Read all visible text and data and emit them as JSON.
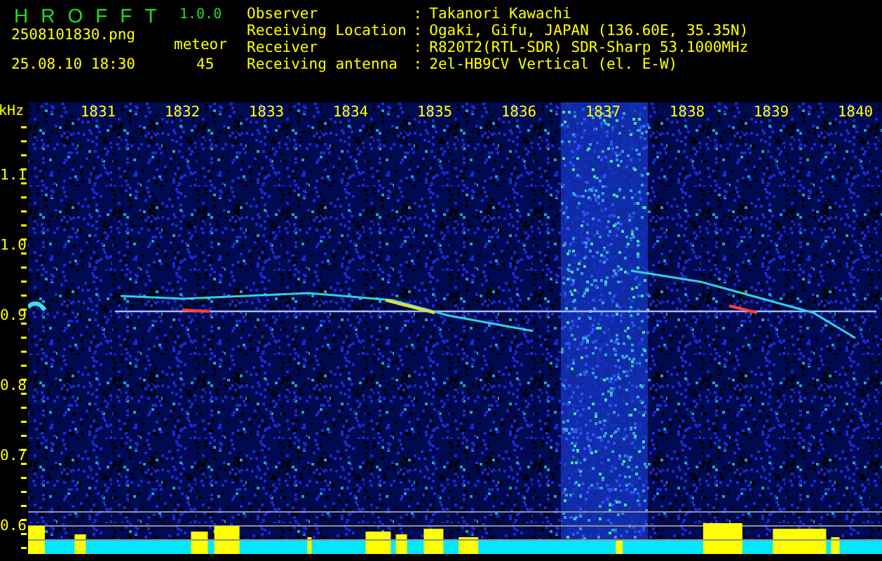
{
  "app": {
    "name": "HROFFT",
    "version": "1.0.0"
  },
  "file": "2508101830.png",
  "datetime": "25.08.10 18:30",
  "count": {
    "label": "meteor",
    "value": "45"
  },
  "separator": ":",
  "info": [
    {
      "label": "Observer",
      "value": "Takanori Kawachi"
    },
    {
      "label": "Receiving Location",
      "value": "Ogaki, Gifu, JAPAN (136.60E, 35.35N)"
    },
    {
      "label": "Receiver",
      "value": "R820T2(RTL-SDR) SDR-Sharp 53.1000MHz"
    },
    {
      "label": "Receiving antenna",
      "value": "2el-HB9CV Vertical (el. E-W)"
    }
  ],
  "y_axis": {
    "unit": "kHz",
    "ticks": [
      "1.1",
      "1.0",
      "0.9",
      "0.8",
      "0.7",
      "0.6"
    ]
  },
  "time_labels": [
    "1831",
    "1832",
    "1833",
    "1834",
    "1835",
    "1836",
    "1837",
    "1838",
    "1839",
    "1840"
  ]
}
